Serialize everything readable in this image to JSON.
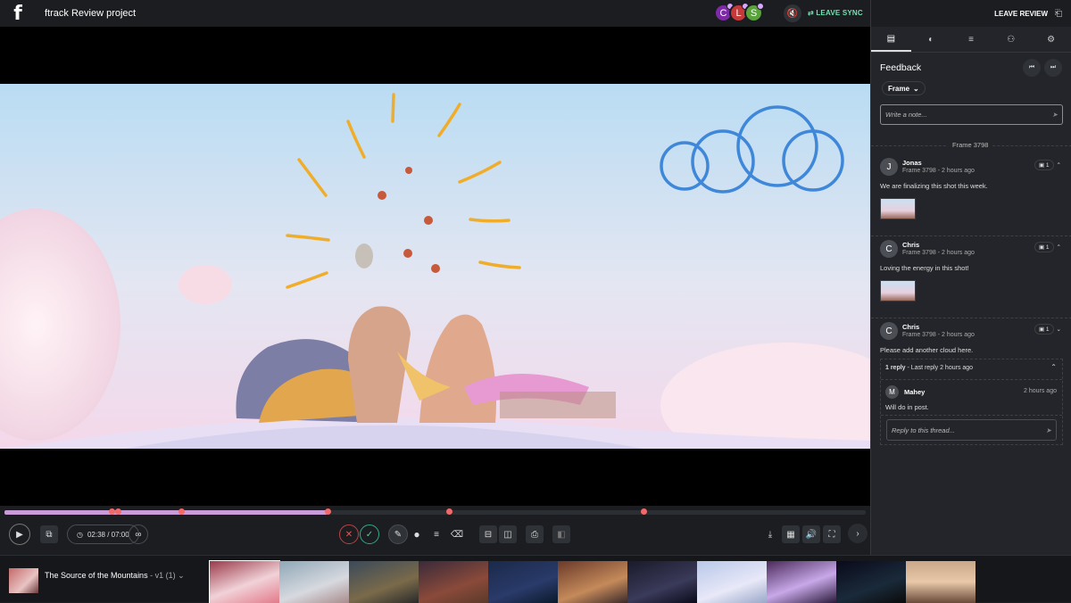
{
  "app": {
    "logo": "f",
    "project_title": "ftrack Review project"
  },
  "header": {
    "participants": [
      {
        "initial": "C",
        "color": "#7c2aa6"
      },
      {
        "initial": "L",
        "color": "#c43a3a"
      },
      {
        "initial": "S",
        "color": "#5aa33a"
      }
    ],
    "mute_icon": "speaker-mute-icon",
    "leave_sync_label": "LEAVE SYNC",
    "leave_review_label": "LEAVE REVIEW"
  },
  "sidebar": {
    "tabs": [
      {
        "icon": "chat-icon",
        "glyph": "▤"
      },
      {
        "icon": "palette-icon",
        "glyph": "◐"
      },
      {
        "icon": "list-icon",
        "glyph": "≡"
      },
      {
        "icon": "add-user-icon",
        "glyph": "⚇"
      },
      {
        "icon": "gear-icon",
        "glyph": "⚙"
      }
    ],
    "title": "Feedback",
    "frame_filter": "Frame",
    "note_placeholder": "Write a note...",
    "frame_separator": "Frame 3798",
    "comments": [
      {
        "initial": "J",
        "author": "Jonas",
        "meta": "Frame 3798 - 2 hours ago",
        "count": "1",
        "text": "We are finalizing this shot this week."
      },
      {
        "initial": "C",
        "author": "Chris",
        "meta": "Frame 3798 - 2 hours ago",
        "count": "1",
        "text": "Loving the energy in this shot!"
      },
      {
        "initial": "C",
        "author": "Chris",
        "meta": "Frame 3798 - 2 hours ago",
        "count": "1",
        "text": "Please add another cloud here."
      }
    ],
    "thread": {
      "reply_count": "1 reply",
      "last_reply": " - Last reply 2 hours ago",
      "reply": {
        "initial": "M",
        "author": "Mahey",
        "time": "2 hours ago",
        "text": "Will do in post."
      },
      "reply_placeholder": "Reply to this thread..."
    }
  },
  "player": {
    "timecode": "02:38 / 07:00",
    "progress_percent": 37.5
  },
  "filmstrip": {
    "clip_name": "The Source of the Mountains",
    "clip_version": " - v1 (1)"
  }
}
